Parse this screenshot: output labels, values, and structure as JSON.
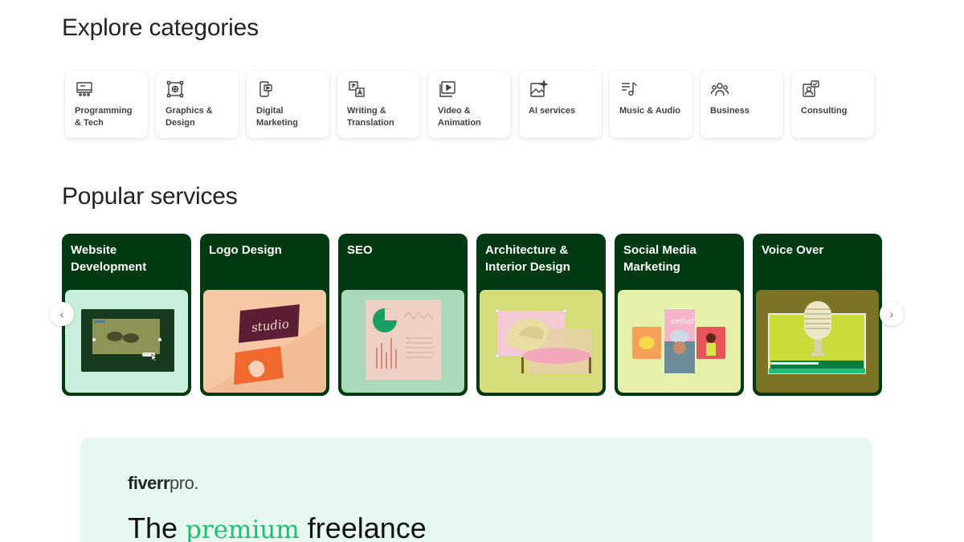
{
  "explore": {
    "title": "Explore categories",
    "categories": [
      {
        "label": "Programming & Tech",
        "icon": "monitor-code-icon"
      },
      {
        "label": "Graphics & Design",
        "icon": "design-frame-icon"
      },
      {
        "label": "Digital Marketing",
        "icon": "phone-marketing-icon"
      },
      {
        "label": "Writing & Translation",
        "icon": "translate-icon"
      },
      {
        "label": "Video & Animation",
        "icon": "video-play-icon"
      },
      {
        "label": "AI services",
        "icon": "ai-image-icon"
      },
      {
        "label": "Music & Audio",
        "icon": "music-note-icon"
      },
      {
        "label": "Business",
        "icon": "people-group-icon"
      },
      {
        "label": "Consulting",
        "icon": "consulting-icon"
      }
    ]
  },
  "popular": {
    "title": "Popular services",
    "services": [
      {
        "label": "Website Development",
        "bg": "#c9f0dc"
      },
      {
        "label": "Logo Design",
        "bg": "#f6c8a6"
      },
      {
        "label": "SEO",
        "bg": "#a9d9b8"
      },
      {
        "label": "Architecture & Interior Design",
        "bg": "#d6dc7a"
      },
      {
        "label": "Social Media Marketing",
        "bg": "#e6f0a8"
      },
      {
        "label": "Voice Over",
        "bg": "#7b7427"
      }
    ],
    "prev_icon": "‹",
    "next_icon": "›"
  },
  "pro": {
    "brand": "fiverr",
    "suffix": "pro.",
    "headline_pre": "The ",
    "headline_accent": "premium",
    "headline_post": " freelance"
  },
  "colors": {
    "card_bg": "#003912",
    "accent": "#1dbf73",
    "banner_bg": "#e7f8f0"
  },
  "service_art": {
    "logo_card_text": "studio",
    "social_card_text": "ambat"
  }
}
